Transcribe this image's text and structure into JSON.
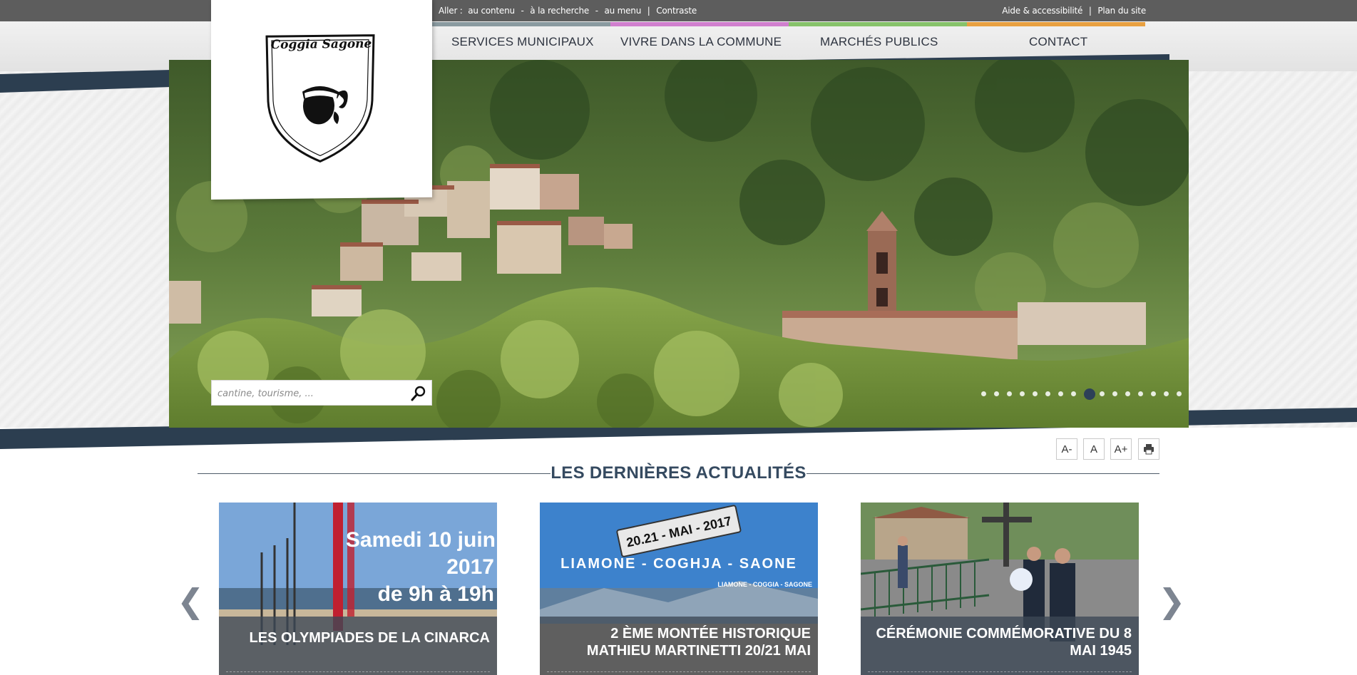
{
  "skip_links": {
    "prefix": "Aller :",
    "items": [
      "au contenu",
      "à la recherche",
      "au menu"
    ],
    "contrast": "Contraste"
  },
  "util_links": [
    "Aide & accessibilité",
    "Plan du site"
  ],
  "logo": {
    "text": "Coggia Sagone"
  },
  "nav": {
    "items": [
      {
        "label": "SERVICES MUNICIPAUX",
        "color": "#8a9aa0"
      },
      {
        "label": "VIVRE DANS LA COMMUNE",
        "color": "#d07fce"
      },
      {
        "label": "MARCHÉS PUBLICS",
        "color": "#86c26a"
      },
      {
        "label": "CONTACT",
        "color": "#e8a040"
      }
    ]
  },
  "search": {
    "placeholder": "cantine, tourisme, ..."
  },
  "slider": {
    "count": 16,
    "active": 8
  },
  "tools": [
    "A-",
    "A",
    "A+"
  ],
  "section": {
    "title": "LES DERNIÈRES ACTUALITÉS"
  },
  "news": [
    {
      "image_text": [
        "Samedi 10 juin",
        "2017",
        "de 9h à 19h"
      ],
      "title": "LES OLYMPIADES DE LA CINARCA"
    },
    {
      "image_text": [
        "20.21 - MAI - 2017",
        "LIAMONE - COGHJA - SAONE",
        "LIAMONE - COGGIA - SAGONE"
      ],
      "title": "2 ÈME MONTÉE HISTORIQUE MATHIEU MARTINETTI 20/21 MAI"
    },
    {
      "image_text": [],
      "title": "CÉRÉMONIE COMMÉMORATIVE DU 8 MAI 1945"
    }
  ],
  "arrows": {
    "prev": "❮",
    "next": "❯"
  },
  "colors": {
    "topbar": "#5d5d5d",
    "accent": "#354a60",
    "band": "#2c3e50"
  }
}
